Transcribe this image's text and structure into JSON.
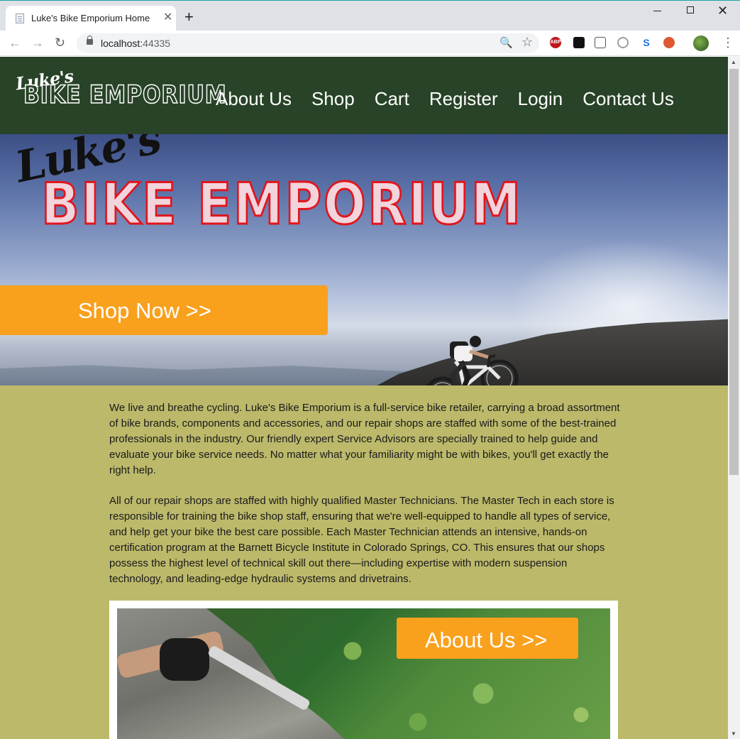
{
  "browser": {
    "tab_title": "Luke's Bike Emporium Home",
    "tab_close": "✕",
    "new_tab": "+",
    "url_host": "localhost:",
    "url_port": "44335",
    "back": "←",
    "forward": "→",
    "reload": "↻",
    "zoom": "🔍",
    "star": "☆",
    "menu": "⋮",
    "ext_abp": "ABP",
    "ext_s": "S"
  },
  "site": {
    "logo_script": "Luke's",
    "logo_main": "BIKE EMPORIUM",
    "nav": [
      "About Us",
      "Shop",
      "Cart",
      "Register",
      "Login",
      "Contact Us"
    ],
    "hero": {
      "script": "Luke's",
      "title": "BIKE EMPORIUM",
      "cta": "Shop Now >>"
    },
    "paragraphs": [
      "We live and breathe cycling. Luke's Bike Emporium is a full-service bike retailer, carrying a broad assortment of bike brands, components and accessories, and our repair shops are staffed with some of the best-trained professionals in the industry. Our friendly expert Service Advisors are specially trained to help guide and evaluate your bike service needs. No matter what your familiarity might be with bikes, you'll get exactly the right help.",
      "All of our repair shops are staffed with highly qualified Master Technicians. The Master Tech in each store is responsible for training the bike shop staff, ensuring that we're well-equipped to handle all types of service, and help get your bike the best care possible. Each Master Technician attends an intensive, hands-on certification program at the Barnett Bicycle Institute in Colorado Springs, CO. This ensures that our shops possess the highest level of technical skill out there—including expertise with modern suspension technology, and leading-edge hydraulic systems and drivetrains."
    ],
    "about_cta": "About Us >>"
  },
  "colors": {
    "header_bg": "#284327",
    "page_bg": "#bcb96b",
    "accent_orange": "#f9a01d",
    "hero_title_red": "#e2151d"
  }
}
